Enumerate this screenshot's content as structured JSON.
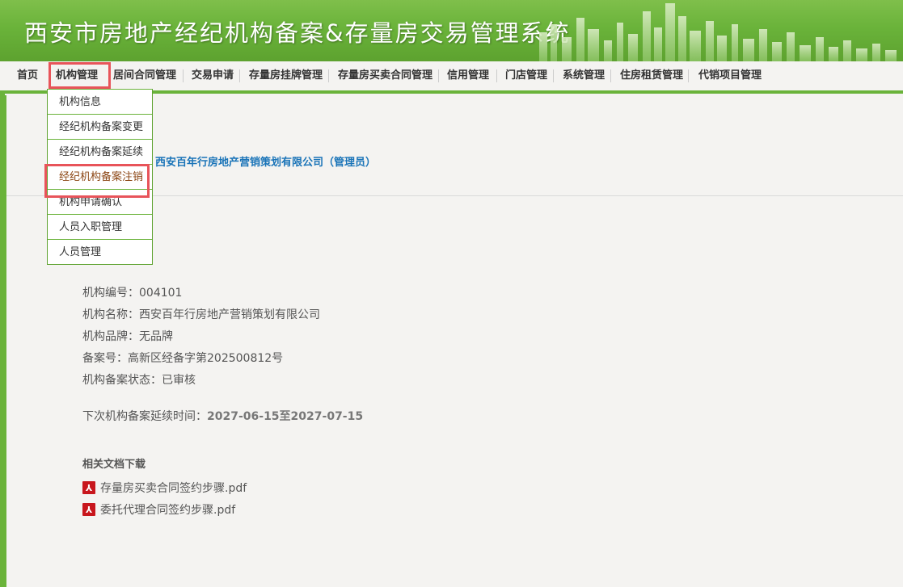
{
  "header": {
    "title": "西安市房地产经纪机构备案&存量房交易管理系统"
  },
  "nav": {
    "items": [
      "首页",
      "机构管理",
      "居间合同管理",
      "交易申请",
      "存量房挂牌管理",
      "存量房买卖合同管理",
      "信用管理",
      "门店管理",
      "系统管理",
      "住房租赁管理",
      "代销项目管理"
    ],
    "active": "机构管理"
  },
  "dropdown": {
    "items": [
      "机构信息",
      "经纪机构备案变更",
      "经纪机构备案延续",
      "经纪机构备案注销",
      "机构申请确认",
      "人员入职管理",
      "人员管理"
    ],
    "selected": "经纪机构备案注销"
  },
  "user": {
    "company_line": "西安百年行房地产营销策划有限公司（管理员）"
  },
  "org": {
    "code_label": "机构编号：",
    "code": "004101",
    "name_label": "机构名称：",
    "name": "西安百年行房地产营销策划有限公司",
    "brand_label": "机构品牌：",
    "brand": "无品牌",
    "record_label": "备案号：",
    "record": "高新区经备字第202500812号",
    "status_label": "机构备案状态：",
    "status": "已审核",
    "next_label": "下次机构备案延续时间：",
    "next_range": "2027-06-15至2027-07-15"
  },
  "docs": {
    "title": "相关文档下载",
    "icon": "pdf-icon",
    "files": [
      "存量房买卖合同签约步骤.pdf",
      "委托代理合同签约步骤.pdf"
    ]
  },
  "colors": {
    "brand_green": "#6ab33a",
    "highlight_red": "#e8545a",
    "link_blue": "#1a74b8"
  }
}
